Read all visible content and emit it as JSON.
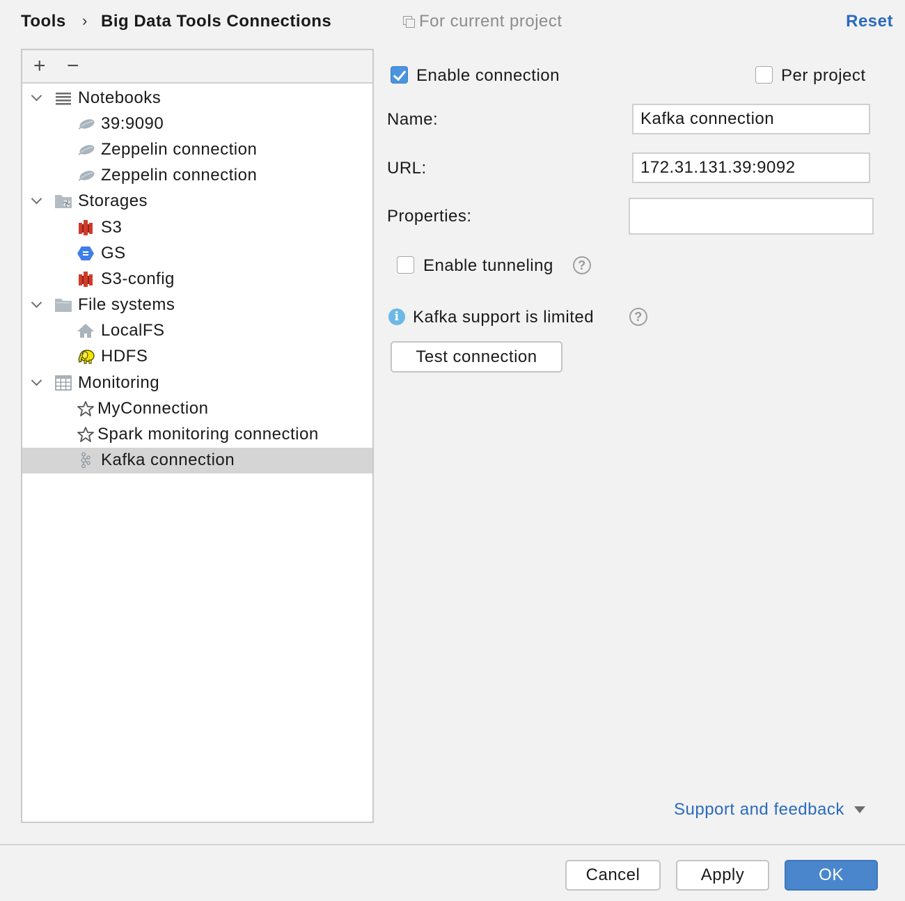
{
  "header": {
    "breadcrumb_root": "Tools",
    "breadcrumb_separator": "›",
    "breadcrumb_page": "Big Data Tools Connections",
    "scope_label": "For current project",
    "reset_label": "Reset"
  },
  "tree_toolbar": {
    "add_label": "+",
    "remove_label": "−"
  },
  "tree": {
    "groups": [
      {
        "label": "Notebooks",
        "icon": "notebook-list-icon",
        "expanded": true,
        "items": [
          {
            "label": "39:9090",
            "icon": "zeppelin-icon"
          },
          {
            "label": "Zeppelin connection",
            "icon": "zeppelin-icon"
          },
          {
            "label": "Zeppelin connection",
            "icon": "zeppelin-icon"
          }
        ]
      },
      {
        "label": "Storages",
        "icon": "storage-folder-icon",
        "expanded": true,
        "items": [
          {
            "label": "S3",
            "icon": "aws-s3-icon"
          },
          {
            "label": "GS",
            "icon": "google-storage-icon"
          },
          {
            "label": "S3-config",
            "icon": "aws-s3-icon"
          }
        ]
      },
      {
        "label": "File systems",
        "icon": "folder-icon",
        "expanded": true,
        "items": [
          {
            "label": "LocalFS",
            "icon": "home-icon"
          },
          {
            "label": "HDFS",
            "icon": "hadoop-elephant-icon"
          }
        ]
      },
      {
        "label": "Monitoring",
        "icon": "table-icon",
        "expanded": true,
        "items": [
          {
            "label": "MyConnection",
            "icon": "spark-star-icon"
          },
          {
            "label": "Spark monitoring connection",
            "icon": "spark-star-icon"
          },
          {
            "label": "Kafka connection",
            "icon": "kafka-icon",
            "selected": true
          }
        ]
      }
    ]
  },
  "form": {
    "enable_connection_label": "Enable connection",
    "enable_connection_checked": true,
    "per_project_label": "Per project",
    "per_project_checked": false,
    "name_label": "Name:",
    "name_value": "Kafka connection",
    "url_label": "URL:",
    "url_value": "172.31.131.39:9092",
    "properties_label": "Properties:",
    "properties_value": "",
    "enable_tunneling_label": "Enable tunneling",
    "enable_tunneling_checked": false,
    "help_glyph": "?",
    "info_glyph": "i",
    "kafka_notice": "Kafka support is limited",
    "test_connection_label": "Test connection"
  },
  "footer": {
    "support_label": "Support and feedback",
    "cancel_label": "Cancel",
    "apply_label": "Apply",
    "ok_label": "OK"
  },
  "colors": {
    "accent": "#4a86cc",
    "link": "#2a6bbd",
    "selection": "#d5d5d5",
    "checkbox_checked": "#4a94e0"
  }
}
